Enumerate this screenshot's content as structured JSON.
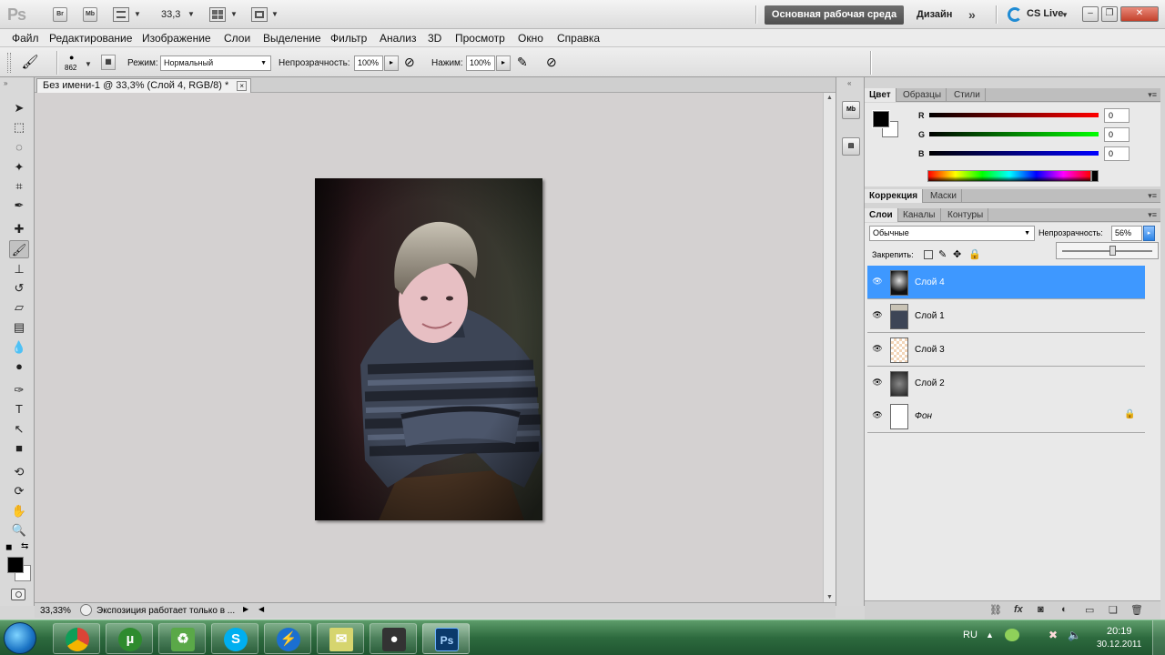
{
  "app": {
    "logo": "Ps",
    "bridge_btn": "Br",
    "minibridge_btn": "Mb",
    "zoom_value": "33,3",
    "workspace_active": "Основная рабочая среда",
    "workspace_design": "Дизайн",
    "more": "»",
    "cslive": "CS Live"
  },
  "menu": [
    "Файл",
    "Редактирование",
    "Изображение",
    "Слои",
    "Выделение",
    "Фильтр",
    "Анализ",
    "3D",
    "Просмотр",
    "Окно",
    "Справка"
  ],
  "options": {
    "brush_size": "862",
    "mode_label": "Режим:",
    "mode_value": "Нормальный",
    "opacity_label": "Непрозрачность:",
    "opacity_value": "100%",
    "pressure_label": "Нажим:",
    "pressure_value": "100%"
  },
  "document": {
    "tab_title": "Без имени-1 @ 33,3% (Слой 4, RGB/8) *",
    "close": "×",
    "status_zoom": "33,33%",
    "status_text": "Экспозиция работает только в ..."
  },
  "color_panel": {
    "tabs": [
      "Цвет",
      "Образцы",
      "Стили"
    ],
    "r_label": "R",
    "g_label": "G",
    "b_label": "B",
    "r_value": "0",
    "g_value": "0",
    "b_value": "0"
  },
  "adjust_panel": {
    "tabs": [
      "Коррекция",
      "Маски"
    ]
  },
  "layers_panel": {
    "tabs": [
      "Слои",
      "Каналы",
      "Контуры"
    ],
    "blend_mode": "Обычные",
    "opacity_label": "Непрозрачность:",
    "opacity_value": "56%",
    "lock_label": "Закрепить:",
    "layers": [
      {
        "name": "Слой 4",
        "selected": true
      },
      {
        "name": "Слой 1",
        "selected": false
      },
      {
        "name": "Слой 3",
        "selected": false
      },
      {
        "name": "Слой 2",
        "selected": false
      },
      {
        "name": "Фон",
        "selected": false,
        "locked": true
      }
    ]
  },
  "taskbar": {
    "lang": "RU",
    "time": "20:19",
    "date": "30.12.2011"
  },
  "colors": {
    "selected_layer": "#3e98ff",
    "workspace_button": "#5f5f5f",
    "taskbar": "#2d6a3e"
  }
}
